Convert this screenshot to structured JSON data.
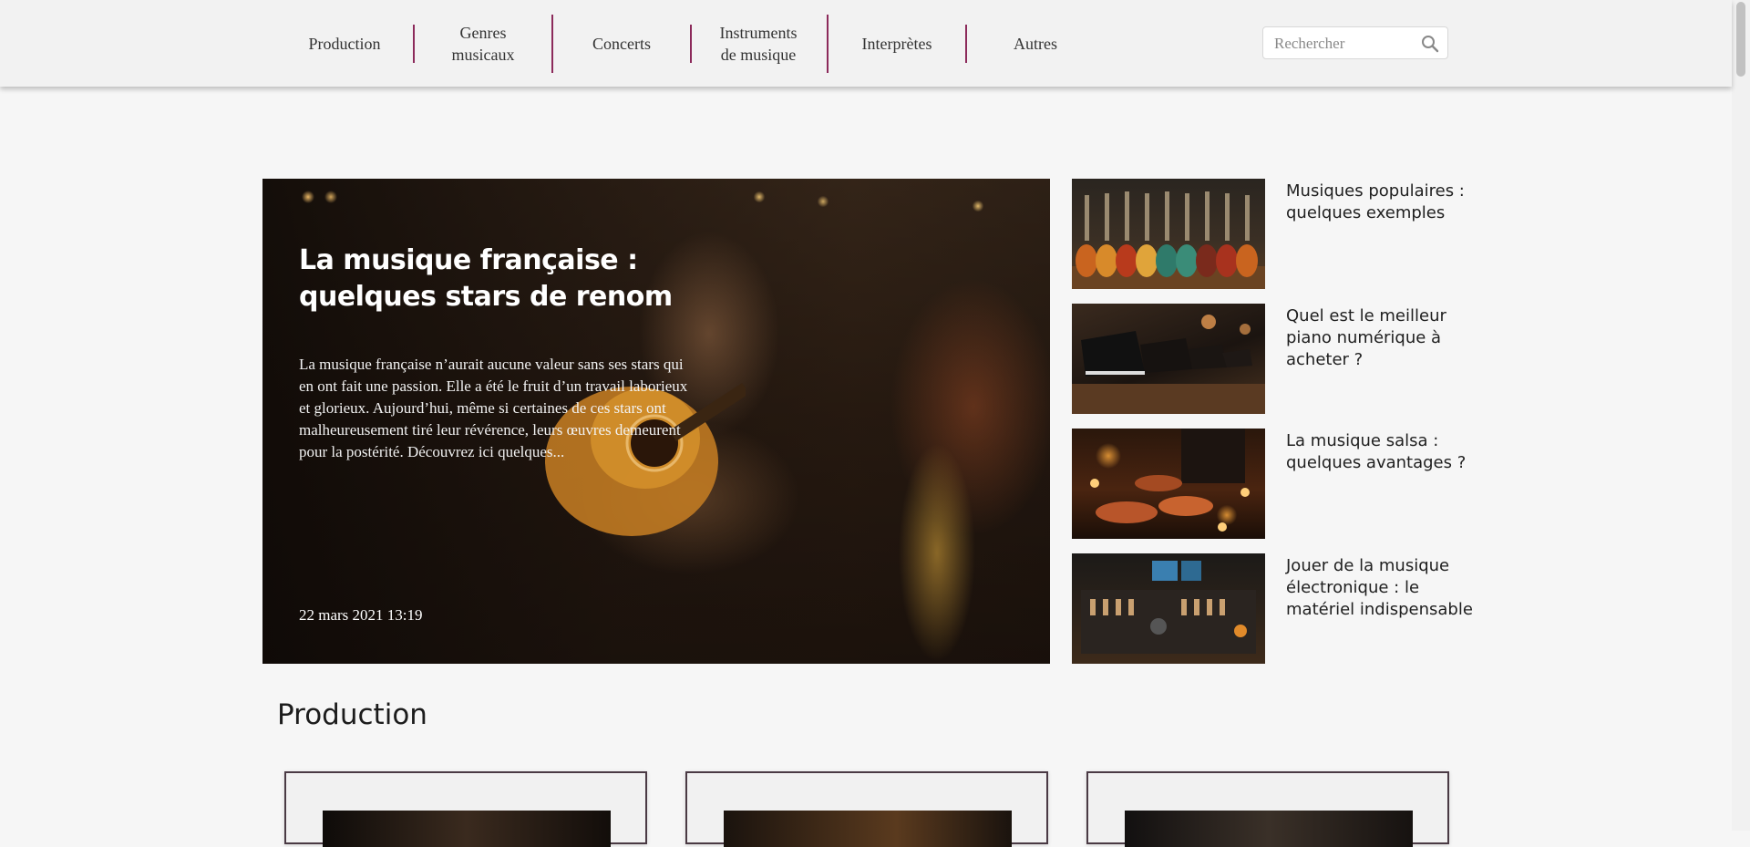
{
  "nav": {
    "items": [
      {
        "line1": "Production",
        "line2": ""
      },
      {
        "line1": "Genres",
        "line2": "musicaux"
      },
      {
        "line1": "Concerts",
        "line2": ""
      },
      {
        "line1": "Instruments",
        "line2": "de musique"
      },
      {
        "line1": "Interprètes",
        "line2": ""
      },
      {
        "line1": "Autres",
        "line2": ""
      }
    ],
    "accent_color": "#8c2a5b"
  },
  "search": {
    "placeholder": "Rechercher",
    "icon": "search-icon"
  },
  "hero": {
    "title": "La musique française : quelques stars de renom",
    "excerpt": "La musique française n’aurait aucune valeur sans ses stars qui en ont fait une passion. Elle a été le fruit d’un travail laborieux et glorieux. Aujourd’hui, même si certaines de ces stars ont malheureusement tiré leur révérence, leurs œuvres demeurent pour la postérité. Découvrez ici quelques...",
    "date": "22 mars 2021 13:19"
  },
  "side_articles": [
    {
      "title": "Musiques populaires : quelques exemples"
    },
    {
      "title": "Quel est le meilleur piano numérique à acheter ?"
    },
    {
      "title": "La musique salsa : quelques avantages ?"
    },
    {
      "title": "Jouer de la musique électronique : le matériel indispensable"
    }
  ],
  "section": {
    "title": "Production"
  }
}
